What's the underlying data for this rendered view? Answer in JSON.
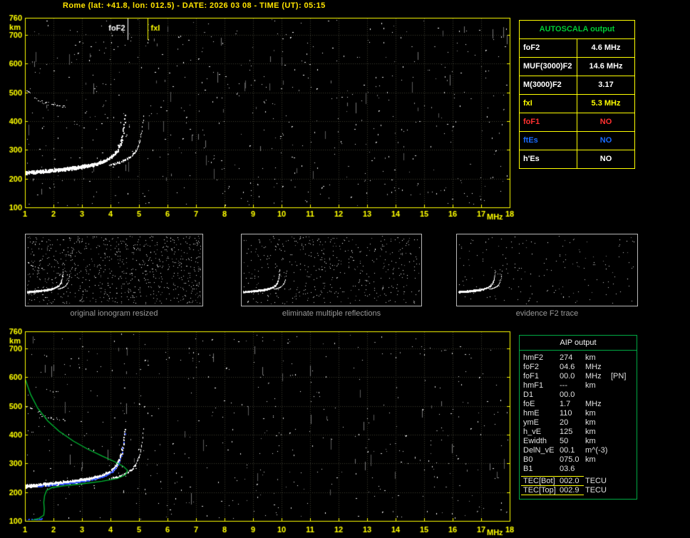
{
  "title": "Rome (lat: +41.8, lon: 012.5) - DATE: 2026 03 08 - TIME (UT): 05:15",
  "colors": {
    "background": "#000000",
    "axis": "#ffff00",
    "title": "#ffe400",
    "grid": "#3c3c30",
    "trace": "#ffffff",
    "profile_green": "#00bb33",
    "restored_blue": "#3355ff",
    "autoscala_border": "#ffff00",
    "autoscala_header": "#00cc33",
    "aip_border": "#00aa44",
    "caption_gray": "#9a9a9a",
    "thumb_border": "#b8b8b8"
  },
  "autoscala": {
    "header": "AUTOSCALA output",
    "rows": [
      {
        "label": "foF2",
        "value": "4.6 MHz",
        "color": "#ffffff"
      },
      {
        "label": "MUF(3000)F2",
        "value": "14.6 MHz",
        "color": "#ffffff"
      },
      {
        "label": "M(3000)F2",
        "value": "3.17",
        "color": "#ffffff"
      },
      {
        "label": "fxI",
        "value": "5.3 MHz",
        "color": "#ffff00"
      },
      {
        "label": "foF1",
        "value": "NO",
        "color": "#ff3030"
      },
      {
        "label": "ftEs",
        "value": "NO",
        "color": "#1a6aff"
      },
      {
        "label": "h'Es",
        "value": "NO",
        "color": "#ffffff"
      }
    ]
  },
  "thumbnails": [
    {
      "caption": "original ionogram resized"
    },
    {
      "caption": "eliminate multiple reflections"
    },
    {
      "caption": "evidence F2 trace"
    }
  ],
  "aip": {
    "header": "AIP output",
    "rows": [
      {
        "name": "hmF2",
        "value": "274",
        "unit": "km",
        "extra": ""
      },
      {
        "name": "foF2",
        "value": "04.6",
        "unit": "MHz",
        "extra": ""
      },
      {
        "name": "foF1",
        "value": "00.0",
        "unit": "MHz",
        "extra": "[PN]"
      },
      {
        "name": "hmF1",
        "value": "---",
        "unit": "km",
        "extra": ""
      },
      {
        "name": "D1",
        "value": "00.0",
        "unit": "",
        "extra": ""
      },
      {
        "name": "foE",
        "value": "1.7",
        "unit": "MHz",
        "extra": ""
      },
      {
        "name": "hmE",
        "value": "110",
        "unit": "km",
        "extra": ""
      },
      {
        "name": "ymE",
        "value": "20",
        "unit": "km",
        "extra": ""
      },
      {
        "name": "h_vE",
        "value": "125",
        "unit": "km",
        "extra": ""
      },
      {
        "name": "Ewidth",
        "value": "50",
        "unit": "km",
        "extra": ""
      },
      {
        "name": "DelN_vE",
        "value": "00.1",
        "unit": "m^(-3)",
        "extra": ""
      },
      {
        "name": "B0",
        "value": "075.0",
        "unit": "km",
        "extra": ""
      },
      {
        "name": "B1",
        "value": "03.6",
        "unit": "",
        "extra": ""
      },
      {
        "name": "TEC[Bot]",
        "value": "002.0",
        "unit": "TECU",
        "extra": ""
      },
      {
        "name": "TEC[Top]",
        "value": "002.9",
        "unit": "TECU",
        "extra": ""
      }
    ]
  },
  "chart_data": [
    {
      "id": "top_ionogram",
      "type": "scatter",
      "description": "Vertical incidence ionogram: virtual height (km) vs sounding frequency (MHz)",
      "xlabel": "MHz",
      "ylabel": "km",
      "xlim": [
        1,
        18
      ],
      "ylim": [
        100,
        760
      ],
      "x_ticks": [
        1,
        2,
        3,
        4,
        5,
        6,
        7,
        8,
        9,
        10,
        11,
        12,
        13,
        14,
        15,
        16,
        17,
        18
      ],
      "y_ticks": [
        760,
        700,
        600,
        500,
        400,
        300,
        200,
        100
      ],
      "grid": true,
      "markers": [
        {
          "label": "foF2",
          "freq_mhz": 4.6,
          "color": "#ffffff",
          "side": "left"
        },
        {
          "label": "fxI",
          "freq_mhz": 5.3,
          "color": "#ffff00",
          "side": "right"
        }
      ],
      "o_trace": {
        "f_start": 1.0,
        "f_end": 4.6,
        "base_km": 223,
        "slope": 6,
        "c": 26,
        "crit_freq": 4.63,
        "max_km": 434
      },
      "x_trace": {
        "f_start": 3.95,
        "f_end": 5.3,
        "offset_mhz": 0.66
      },
      "second_hop": {
        "f_start": 1.05,
        "f_end": 2.45,
        "base_km": 448,
        "amp_km": 60,
        "decay": 0.5
      },
      "noise": {
        "seed": 11,
        "dots": 540,
        "streaks": 60
      }
    },
    {
      "id": "bottom_ionogram",
      "type": "scatter",
      "description": "Autoscaled ionogram with restored trace (blue) and electron density profile (green)",
      "xlabel": "MHz",
      "ylabel": "km",
      "xlim": [
        1,
        18
      ],
      "ylim": [
        100,
        760
      ],
      "x_ticks": [
        1,
        2,
        3,
        4,
        5,
        6,
        7,
        8,
        9,
        10,
        11,
        12,
        13,
        14,
        15,
        16,
        17,
        18
      ],
      "y_ticks": [
        760,
        700,
        600,
        500,
        400,
        300,
        200,
        100
      ],
      "grid": true,
      "o_trace": {
        "f_start": 1.0,
        "f_end": 4.6,
        "base_km": 223,
        "slope": 6,
        "c": 26,
        "crit_freq": 4.63,
        "max_km": 434
      },
      "x_trace": {
        "f_start": 3.95,
        "f_end": 5.3,
        "offset_mhz": 0.66
      },
      "second_hop": {
        "f_start": 1.05,
        "f_end": 2.45,
        "base_km": 448,
        "amp_km": 60,
        "decay": 0.5
      },
      "restored_trace": {
        "color": "#3355ff",
        "f_start": 1.45,
        "f_end": 4.52
      },
      "es_trace": {
        "color": "#2a50ff",
        "f_start": 1.0,
        "f_end": 1.62,
        "km": 107
      },
      "profile": {
        "color": "#00bb33",
        "points_f_km": [
          [
            1.02,
            591
          ],
          [
            1.2,
            540
          ],
          [
            1.45,
            492
          ],
          [
            1.8,
            448
          ],
          [
            2.2,
            412
          ],
          [
            2.7,
            378
          ],
          [
            3.2,
            350
          ],
          [
            3.7,
            326
          ],
          [
            4.15,
            306
          ],
          [
            4.45,
            290
          ],
          [
            4.6,
            276
          ],
          [
            4.52,
            260
          ],
          [
            4.25,
            248
          ],
          [
            3.7,
            238
          ],
          [
            3.0,
            229
          ],
          [
            2.35,
            222
          ],
          [
            1.95,
            216
          ],
          [
            1.76,
            206
          ],
          [
            1.69,
            188
          ],
          [
            1.66,
            165
          ],
          [
            1.68,
            140
          ],
          [
            1.66,
            120
          ],
          [
            1.5,
            109
          ],
          [
            1.25,
            102
          ],
          [
            1.05,
            97
          ]
        ]
      },
      "noise": {
        "seed": 22,
        "dots": 460,
        "streaks": 45
      }
    },
    {
      "id": "thumb_original_resized",
      "type": "scatter",
      "noise_seed": 33,
      "noise_dots": 800,
      "second_hop": true
    },
    {
      "id": "thumb_eliminate_reflections",
      "type": "scatter",
      "noise_seed": 44,
      "noise_dots": 470,
      "second_hop": false
    },
    {
      "id": "thumb_evidence_f2_trace",
      "type": "scatter",
      "noise_seed": 55,
      "noise_dots": 170,
      "second_hop": false
    }
  ]
}
